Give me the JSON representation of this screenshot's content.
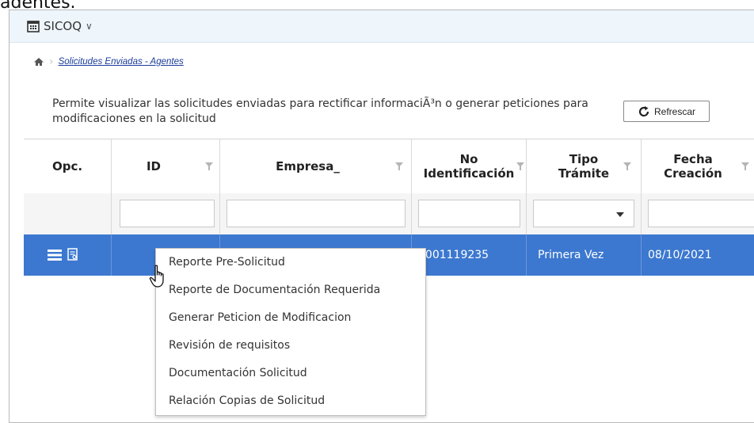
{
  "page_top_clip_text": "adentes.",
  "app": {
    "title": "SICOQ",
    "caret": "∨"
  },
  "breadcrumb": {
    "home_icon": "home-icon",
    "link": "Solicitudes Enviadas - Agentes"
  },
  "description": "Permite visualizar las solicitudes enviadas para rectificar informaciÃ³n o generar peticiones para modificaciones en la solicitud",
  "refresh_button": {
    "label": "Refrescar",
    "icon": "refresh-icon"
  },
  "grid": {
    "columns": [
      {
        "label": "Opc.",
        "filter_icon": false
      },
      {
        "label": "ID",
        "filter_icon": true
      },
      {
        "label": "Empresa_",
        "filter_icon": true
      },
      {
        "label": "No Identificación",
        "filter_icon": true
      },
      {
        "label": "Tipo Trámite",
        "filter_icon": true
      },
      {
        "label": "Fecha Creación",
        "filter_icon": true
      }
    ],
    "row": {
      "id": "",
      "empresa": "",
      "no_identificacion": "1001119235",
      "tipo_tramite": "Primera Vez",
      "fecha_creacion": "08/10/2021"
    },
    "selected_row_color": "#3c78d0"
  },
  "context_menu": {
    "items": [
      "Reporte Pre-Solicitud",
      "Reporte de Documentación Requerida",
      "Generar Peticion de Modificacion",
      "Revisión de requisitos",
      "Documentación Solicitud",
      "Relación Copias de Solicitud"
    ]
  }
}
